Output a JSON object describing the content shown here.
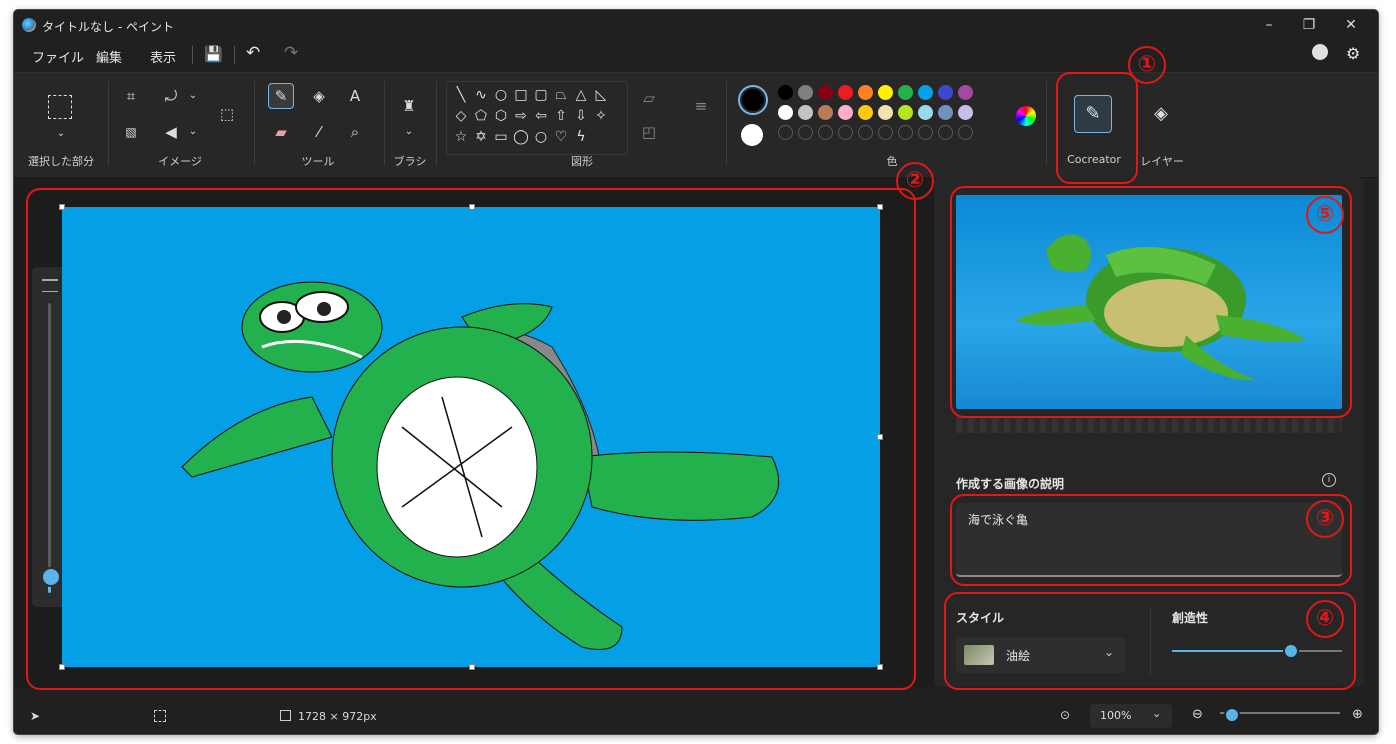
{
  "window": {
    "title": "タイトルなし - ペイント"
  },
  "menu": {
    "file": "ファイル",
    "edit": "編集",
    "view": "表示"
  },
  "ribbon": {
    "groups": {
      "selection": "選択した部分",
      "image": "イメージ",
      "tools": "ツール",
      "brush": "ブラシ",
      "shapes": "図形",
      "colors": "色",
      "cocreator": "Cocreator",
      "layers": "レイヤー"
    },
    "colors_row1": [
      "#000000",
      "#7f7f7f",
      "#880015",
      "#ed1c24",
      "#ff7f27",
      "#fff200",
      "#22b14c",
      "#00a2e8",
      "#3f48cc",
      "#a349a4"
    ],
    "colors_row2": [
      "#ffffff",
      "#c3c3c3",
      "#b97a57",
      "#ffaec9",
      "#ffc90e",
      "#efe4b0",
      "#b5e61d",
      "#99d9ea",
      "#7092be",
      "#c8bfe7"
    ]
  },
  "cocreator": {
    "description_label": "作成する画像の説明",
    "prompt": "海で泳ぐ亀",
    "style_label": "スタイル",
    "style_value": "油絵",
    "creativity_label": "創造性",
    "creativity_level": 0.7
  },
  "status": {
    "canvas_size": "1728 × 972px",
    "zoom": "100%"
  },
  "annotations": [
    "①",
    "②",
    "③",
    "④",
    "⑤"
  ]
}
